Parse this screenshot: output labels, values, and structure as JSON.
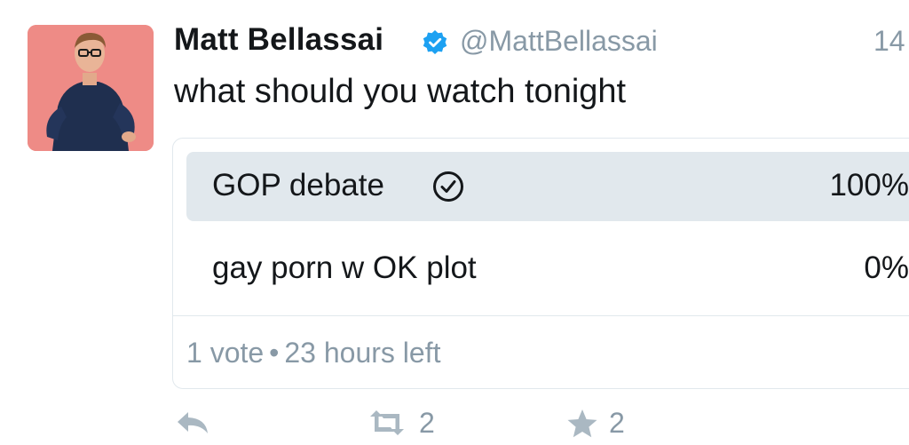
{
  "tweet": {
    "author_name": "Matt Bellassai",
    "handle": "@MattBellassai",
    "timestamp": "14",
    "text": "what should you watch tonight",
    "verified": true,
    "verified_icon": "verified-badge-icon",
    "accent_color": "#1da1f2",
    "muted_color": "#8899a6"
  },
  "poll": {
    "options": [
      {
        "label": "GOP debate",
        "percent": "100%",
        "winner": true,
        "icon": "check-circle-icon"
      },
      {
        "label": "gay porn w OK plot",
        "percent": "0%",
        "winner": false
      }
    ],
    "votes": "1 vote",
    "separator": "•",
    "time_left": "23 hours left",
    "winner_fill_color": "#e1e8ed"
  },
  "actions": {
    "reply_icon": "reply-icon",
    "retweet_icon": "retweet-icon",
    "retweet_count": "2",
    "like_icon": "star-icon",
    "like_count": "2"
  }
}
